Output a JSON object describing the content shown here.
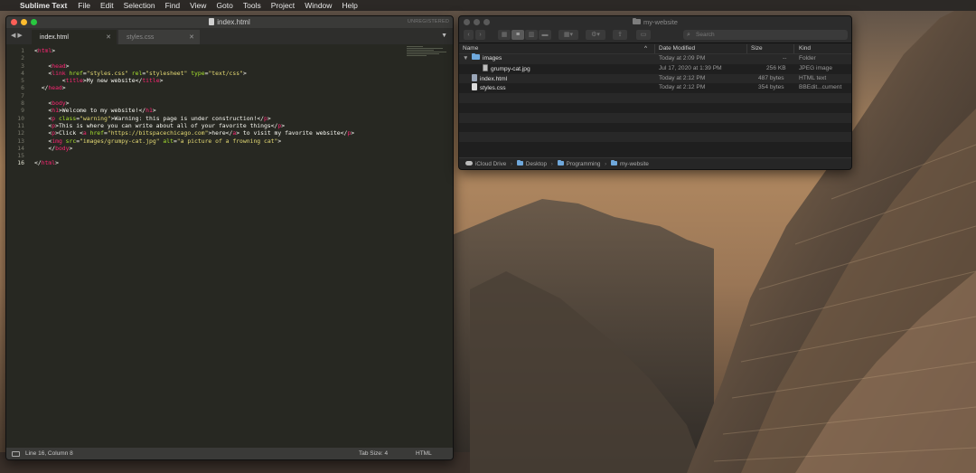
{
  "menubar": {
    "apple_icon": "",
    "app_name": "Sublime Text",
    "items": [
      "File",
      "Edit",
      "Selection",
      "Find",
      "View",
      "Goto",
      "Tools",
      "Project",
      "Window",
      "Help"
    ]
  },
  "sublime": {
    "title": "index.html",
    "unregistered": "UNREGISTERED",
    "nav_arrows": "◀ ▶",
    "tabs": [
      {
        "label": "index.html",
        "close": "✕"
      },
      {
        "label": "styles.css",
        "close": "✕"
      }
    ],
    "tab_menu": "▼",
    "line_numbers": [
      "1",
      "2",
      "3",
      "4",
      "5",
      "6",
      "7",
      "8",
      "9",
      "10",
      "11",
      "12",
      "13",
      "14",
      "15",
      "16"
    ],
    "status": {
      "position": "Line 16, Column 8",
      "tab_size": "Tab Size: 4",
      "syntax": "HTML"
    }
  },
  "code_lines": [
    [
      {
        "c": "tx",
        "t": "<"
      },
      {
        "c": "tg",
        "t": "html"
      },
      {
        "c": "tx",
        "t": ">"
      }
    ],
    [],
    [
      {
        "c": "tx",
        "t": "    <"
      },
      {
        "c": "tg",
        "t": "head"
      },
      {
        "c": "tx",
        "t": ">"
      }
    ],
    [
      {
        "c": "tx",
        "t": "    <"
      },
      {
        "c": "tg",
        "t": "link"
      },
      {
        "c": "at",
        "t": " href"
      },
      {
        "c": "tx",
        "t": "="
      },
      {
        "c": "st",
        "t": "\"styles.css\""
      },
      {
        "c": "at",
        "t": " rel"
      },
      {
        "c": "tx",
        "t": "="
      },
      {
        "c": "st",
        "t": "\"stylesheet\""
      },
      {
        "c": "at",
        "t": " type"
      },
      {
        "c": "tx",
        "t": "="
      },
      {
        "c": "st",
        "t": "\"text/css\""
      },
      {
        "c": "tx",
        "t": ">"
      }
    ],
    [
      {
        "c": "tx",
        "t": "        <"
      },
      {
        "c": "tg",
        "t": "title"
      },
      {
        "c": "tx",
        "t": ">My new website</"
      },
      {
        "c": "tg",
        "t": "title"
      },
      {
        "c": "tx",
        "t": ">"
      }
    ],
    [
      {
        "c": "tx",
        "t": "  </"
      },
      {
        "c": "tg",
        "t": "head"
      },
      {
        "c": "tx",
        "t": ">"
      }
    ],
    [],
    [
      {
        "c": "tx",
        "t": "    <"
      },
      {
        "c": "tg",
        "t": "body"
      },
      {
        "c": "tx",
        "t": ">"
      }
    ],
    [
      {
        "c": "tx",
        "t": "    <"
      },
      {
        "c": "tg",
        "t": "h1"
      },
      {
        "c": "tx",
        "t": ">Welcome to my website!</"
      },
      {
        "c": "tg",
        "t": "h1"
      },
      {
        "c": "tx",
        "t": ">"
      }
    ],
    [
      {
        "c": "tx",
        "t": "    <"
      },
      {
        "c": "tg",
        "t": "p"
      },
      {
        "c": "at",
        "t": " class"
      },
      {
        "c": "tx",
        "t": "="
      },
      {
        "c": "st",
        "t": "\"warning\""
      },
      {
        "c": "tx",
        "t": ">Warning: this page is under construction!</"
      },
      {
        "c": "tg",
        "t": "p"
      },
      {
        "c": "tx",
        "t": ">"
      }
    ],
    [
      {
        "c": "tx",
        "t": "    <"
      },
      {
        "c": "tg",
        "t": "p"
      },
      {
        "c": "tx",
        "t": ">This is where you can write about all of your favorite things</"
      },
      {
        "c": "tg",
        "t": "p"
      },
      {
        "c": "tx",
        "t": ">"
      }
    ],
    [
      {
        "c": "tx",
        "t": "    <"
      },
      {
        "c": "tg",
        "t": "p"
      },
      {
        "c": "tx",
        "t": ">Click <"
      },
      {
        "c": "tg",
        "t": "a"
      },
      {
        "c": "at",
        "t": " href"
      },
      {
        "c": "tx",
        "t": "="
      },
      {
        "c": "st",
        "t": "\"https://bitspacechicago.com\""
      },
      {
        "c": "tx",
        "t": ">here</"
      },
      {
        "c": "tg",
        "t": "a"
      },
      {
        "c": "tx",
        "t": "> to visit my favorite website</"
      },
      {
        "c": "tg",
        "t": "p"
      },
      {
        "c": "tx",
        "t": ">"
      }
    ],
    [
      {
        "c": "tx",
        "t": "    <"
      },
      {
        "c": "tg",
        "t": "img"
      },
      {
        "c": "at",
        "t": " src"
      },
      {
        "c": "tx",
        "t": "="
      },
      {
        "c": "st",
        "t": "\"images/grumpy-cat.jpg\""
      },
      {
        "c": "at",
        "t": " alt"
      },
      {
        "c": "tx",
        "t": "="
      },
      {
        "c": "st",
        "t": "\"a picture of a frowning cat\""
      },
      {
        "c": "tx",
        "t": ">"
      }
    ],
    [
      {
        "c": "tx",
        "t": "    </"
      },
      {
        "c": "tg",
        "t": "body"
      },
      {
        "c": "tx",
        "t": ">"
      }
    ],
    [],
    [
      {
        "c": "tx",
        "t": "</"
      },
      {
        "c": "tg",
        "t": "html"
      },
      {
        "c": "tx",
        "t": ">"
      }
    ]
  ],
  "finder": {
    "title": "my-website",
    "search_placeholder": "Search",
    "toolbar_icons": [
      "back-icon",
      "forward-icon",
      "icon-view-icon",
      "list-view-icon",
      "column-view-icon",
      "gallery-view-icon",
      "group-icon",
      "action-gear-icon",
      "share-icon",
      "tag-icon"
    ],
    "columns": {
      "name": "Name",
      "date": "Date Modified",
      "size": "Size",
      "kind": "Kind"
    },
    "sort_indicator": "^",
    "rows": [
      {
        "name": "images",
        "date": "Today at 2:09 PM",
        "size": "--",
        "kind": "Folder",
        "disclosure": "▼"
      },
      {
        "name": "grumpy-cat.jpg",
        "date": "Jul 17, 2020 at 1:39 PM",
        "size": "256 KB",
        "kind": "JPEG image"
      },
      {
        "name": "index.html",
        "date": "Today at 2:12 PM",
        "size": "487 bytes",
        "kind": "HTML text"
      },
      {
        "name": "styles.css",
        "date": "Today at 2:12 PM",
        "size": "354 bytes",
        "kind": "BBEdit...cument"
      }
    ],
    "path": [
      "iCloud Drive",
      "Desktop",
      "Programming",
      "my-website"
    ],
    "path_sep": "›"
  },
  "colors": {
    "sublime_bg": "#272822",
    "tag": "#f92672",
    "attr": "#a6e22e",
    "string": "#e6db74",
    "folder": "#6fa8dc"
  }
}
